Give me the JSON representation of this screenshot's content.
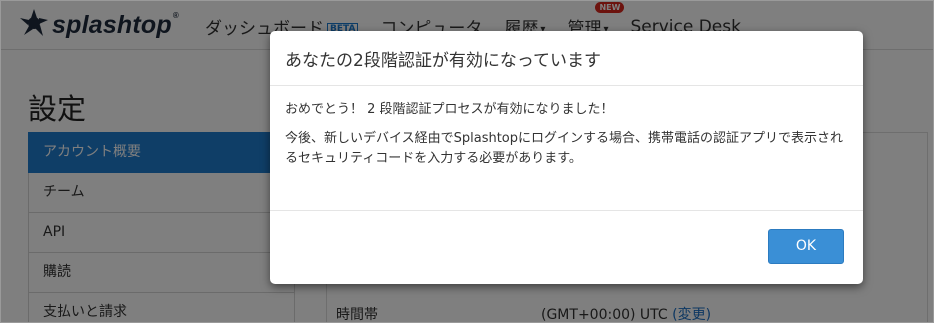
{
  "topnav": {
    "logo": {
      "text": "splashtop",
      "mark": "®"
    },
    "items": [
      {
        "label": "ダッシュボード",
        "badge": "BETA"
      },
      {
        "label": "コンピュータ"
      },
      {
        "label": "履歴",
        "caret": "▾"
      },
      {
        "label": "管理",
        "caret": "▾",
        "badge": "NEW"
      },
      {
        "label": "Service Desk"
      }
    ]
  },
  "page": {
    "title": "設定",
    "sidebar": [
      {
        "label": "アカウント概要",
        "active": true
      },
      {
        "label": "チーム"
      },
      {
        "label": "API"
      },
      {
        "label": "購読"
      },
      {
        "label": "支払いと請求"
      }
    ],
    "timezone_row": {
      "label": "時間帯",
      "value": "(GMT+00:00) UTC",
      "change_link": "(変更)"
    }
  },
  "modal": {
    "title": "あなたの2段階認証が有効になっています",
    "message1": "おめでとう！ 2 段階認証プロセスが有効になりました！",
    "message2": "今後、新しいデバイス経由でSplashtopにログインする場合、携帯電話の認証アプリで表示されるセキュリティコードを入力する必要があります。",
    "ok_label": "OK"
  },
  "colors": {
    "brand_dark": "#1f2b3d",
    "accent_blue": "#1f7ccf",
    "button_blue": "#3a8fd6",
    "new_badge_red": "#d9261c",
    "overlay": "rgba(0,0,0,0.5)"
  }
}
